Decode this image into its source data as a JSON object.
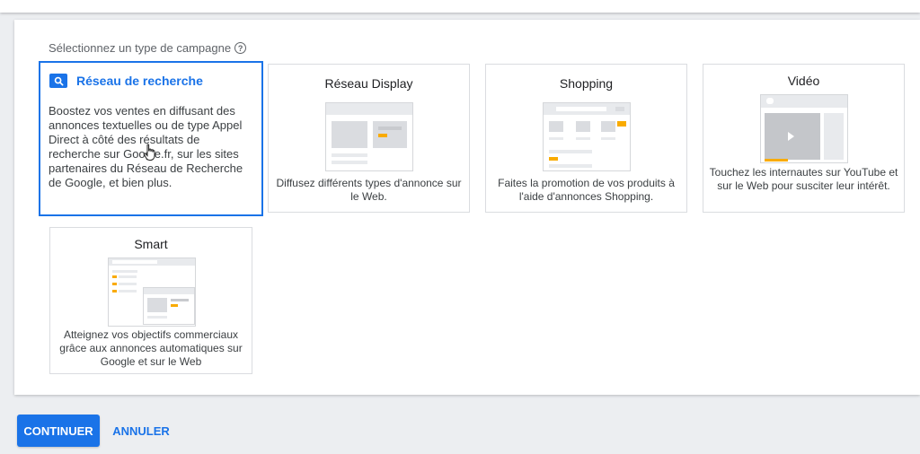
{
  "section": {
    "label": "Sélectionnez un type de campagne"
  },
  "cards": {
    "search": {
      "title": "Réseau de recherche",
      "description": "Boostez vos ventes en diffusant des annonces textuelles ou de type Appel Direct à côté des résultats de recherche sur Google.fr, sur les sites partenaires du Réseau de Recherche de Google, et bien plus.",
      "selected": true
    },
    "display": {
      "title": "Réseau Display",
      "description": "Diffusez différents types d'annonce sur le Web."
    },
    "shopping": {
      "title": "Shopping",
      "description": "Faites la promotion de vos produits à l'aide d'annonces Shopping."
    },
    "video": {
      "title": "Vidéo",
      "description": "Touchez les internautes sur YouTube et sur le Web pour susciter leur intérêt."
    },
    "smart": {
      "title": "Smart",
      "description": "Atteignez vos objectifs commerciaux grâce aux annonces automatiques sur Google et sur le Web"
    }
  },
  "actions": {
    "continue_label": "CONTINUER",
    "cancel_label": "ANNULER"
  },
  "colors": {
    "accent": "#1a73e8",
    "highlight": "#f9ab00",
    "background": "#eceef1"
  }
}
